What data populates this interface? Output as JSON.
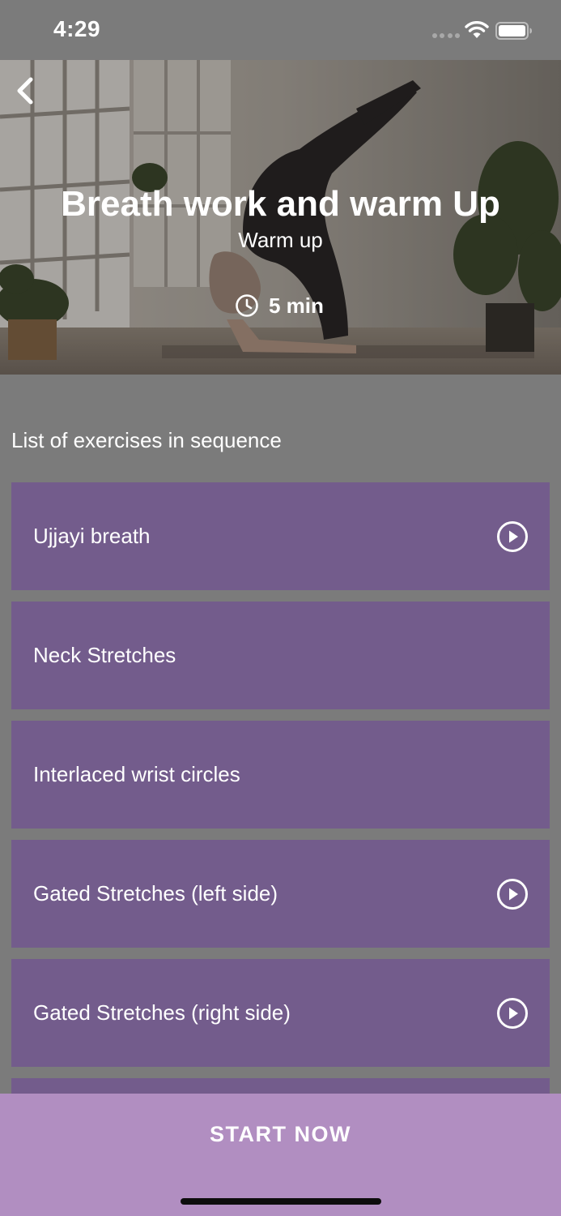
{
  "status_bar": {
    "time": "4:29"
  },
  "hero": {
    "title": "Breath work and warm Up",
    "subtitle": "Warm up",
    "duration": "5 min"
  },
  "list": {
    "heading": "List of exercises in sequence",
    "items": [
      {
        "label": "Ujjayi breath",
        "has_play": true
      },
      {
        "label": "Neck Stretches",
        "has_play": false
      },
      {
        "label": "Interlaced wrist circles",
        "has_play": false
      },
      {
        "label": "Gated Stretches (left side)",
        "has_play": true
      },
      {
        "label": "Gated Stretches (right side)",
        "has_play": true
      },
      {
        "label": "",
        "has_play": false
      }
    ]
  },
  "actions": {
    "start_label": "START NOW"
  },
  "colors": {
    "background": "#7b7b7b",
    "item_background": "#735c8c",
    "start_button": "#b18ec1",
    "text": "#ffffff"
  },
  "icons": {
    "back": "chevron-left-icon",
    "clock": "clock-icon",
    "play": "play-circle-icon",
    "wifi": "wifi-icon",
    "battery": "battery-icon"
  }
}
